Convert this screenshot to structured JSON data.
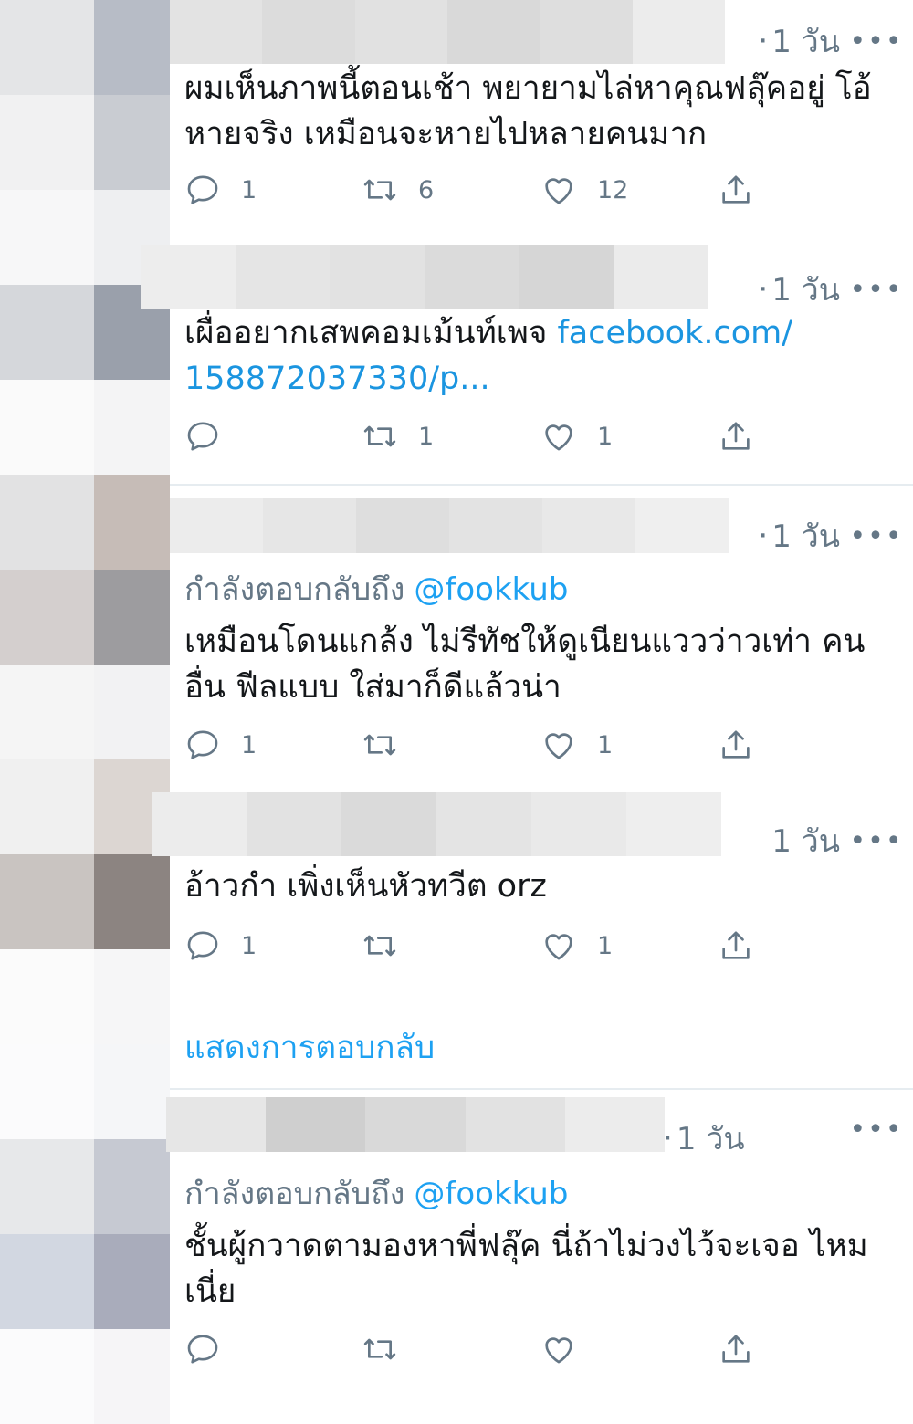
{
  "colors": {
    "link": "#1b95e0",
    "handle": "#1da1f2",
    "meta": "#657786",
    "text": "#14171a",
    "separator": "#e6ecf0"
  },
  "icons": [
    "reply-icon",
    "retweet-icon",
    "like-icon",
    "share-icon",
    "more-icon"
  ],
  "tweets": [
    {
      "time": "1 วัน",
      "more": "•••",
      "body": "ผมเห็นภาพนี้ตอนเช้า  พยายามไล่หาคุณฟลุ๊คอยู่ โอ้ หายจริง เหมือนจะหายไปหลายคนมาก",
      "replies": "1",
      "retweets": "6",
      "likes": "12"
    },
    {
      "time": "1 วัน",
      "more": "•••",
      "body": "เผื่ออยากเสพคอมเม้นท์เพจ ",
      "link": "facebook.com/ 158872037330/p...",
      "replies": "",
      "retweets": "1",
      "likes": "1"
    },
    {
      "time": "1 วัน",
      "more": "•••",
      "reply_label": "กำลังตอบกลับถึง",
      "reply_handle": "@fookkub",
      "body": "เหมือนโดนแกล้ง ไม่รีทัชให้ดูเนียนแววว่าวเท่า คนอื่น ฟีลแบบ ใส่มาก็ดีแล้วน่า",
      "replies": "1",
      "retweets": "",
      "likes": "1"
    },
    {
      "time": "1 วัน",
      "more": "•••",
      "body": "อ้าวกำ เพิ่งเห็นหัวทวีต orz",
      "replies": "1",
      "retweets": "",
      "likes": "1"
    },
    {
      "time": "1 วัน",
      "more": "•••",
      "reply_label": "กำลังตอบกลับถึง",
      "reply_handle": "@fookkub",
      "body": "ชั้นผู้กวาดตามองหาพี่ฟลุ๊ค นี่ถ้าไม่วงไว้จะเจอ ไหมเนี่ย",
      "replies": "",
      "retweets": "",
      "likes": ""
    }
  ],
  "show_replies": "แสดงการตอบกลับ"
}
